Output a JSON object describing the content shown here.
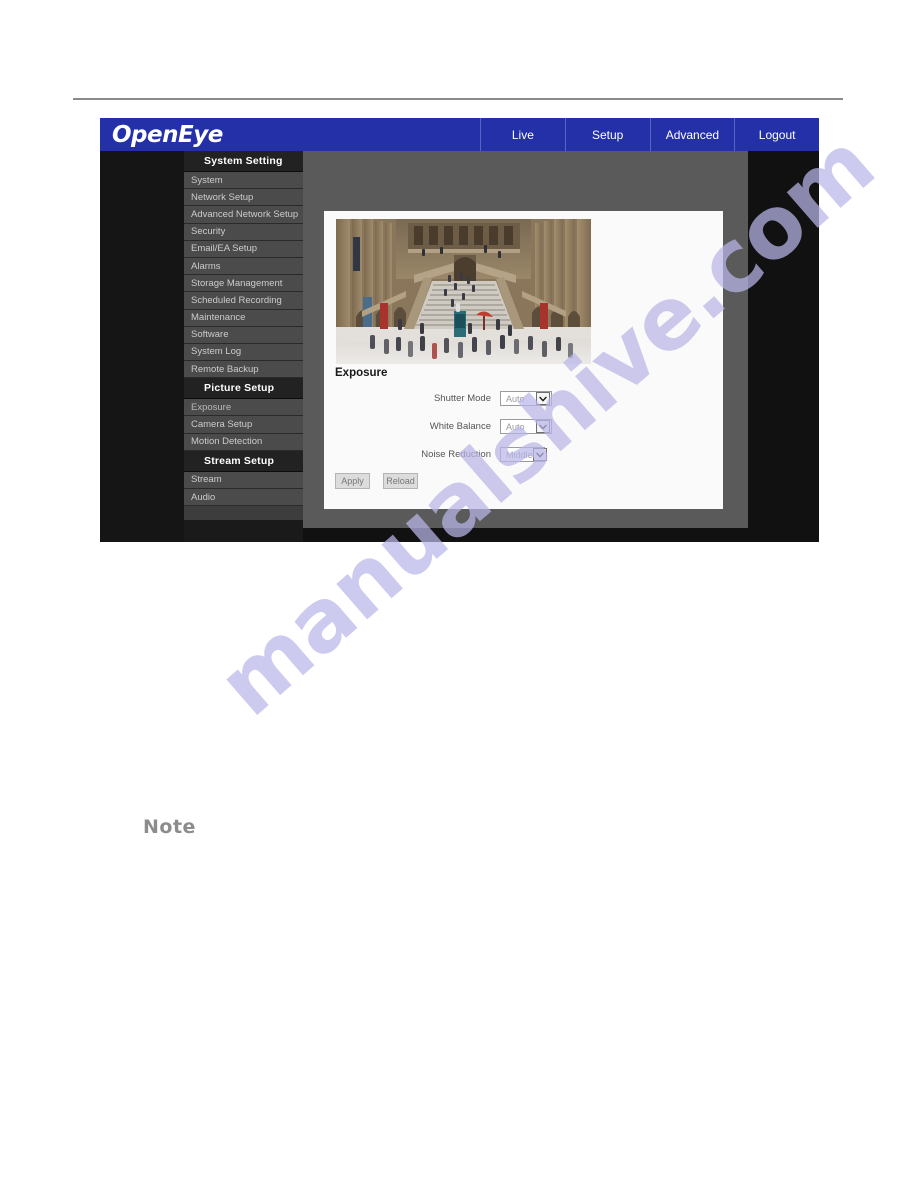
{
  "page": {
    "note_label": "Note",
    "watermark_text": "manualshive.com",
    "watermark_color": "#b9b6e8"
  },
  "app": {
    "brand": "OpenEye",
    "header_color": "#2330a8",
    "nav_tabs": [
      {
        "label": "Live"
      },
      {
        "label": "Setup"
      },
      {
        "label": "Advanced"
      },
      {
        "label": "Logout"
      }
    ]
  },
  "sidebar": {
    "groups": [
      {
        "header": "System Setting",
        "items": [
          {
            "label": "System",
            "active": false
          },
          {
            "label": "Network Setup",
            "active": false
          },
          {
            "label": "Advanced Network Setup",
            "active": false
          },
          {
            "label": "Security",
            "active": false
          },
          {
            "label": "Email/EA Setup",
            "active": false
          },
          {
            "label": "Alarms",
            "active": false
          },
          {
            "label": "Storage Management",
            "active": false
          },
          {
            "label": "Scheduled Recording",
            "active": false
          },
          {
            "label": "Maintenance",
            "active": false
          },
          {
            "label": "Software",
            "active": false
          },
          {
            "label": "System Log",
            "active": false
          },
          {
            "label": "Remote Backup",
            "active": false
          }
        ]
      },
      {
        "header": "Picture Setup",
        "items": [
          {
            "label": "Exposure",
            "active": true
          },
          {
            "label": "Camera Setup",
            "active": false
          },
          {
            "label": "Motion Detection",
            "active": false
          }
        ]
      },
      {
        "header": "Stream Setup",
        "items": [
          {
            "label": "Stream",
            "active": false
          },
          {
            "label": "Audio",
            "active": false
          }
        ]
      }
    ]
  },
  "main": {
    "section_title": "Exposure",
    "preview_alt": "live camera preview of museum great hall with staircase and visitors",
    "fields": [
      {
        "label": "Shutter Mode",
        "value": "Auto",
        "width": "wide"
      },
      {
        "label": "White Balance",
        "value": "Auto",
        "width": "wide"
      },
      {
        "label": "Noise Reduction",
        "value": "Middle",
        "width": "narrow"
      }
    ],
    "buttons": [
      {
        "label": "Apply"
      },
      {
        "label": "Reload"
      }
    ]
  }
}
